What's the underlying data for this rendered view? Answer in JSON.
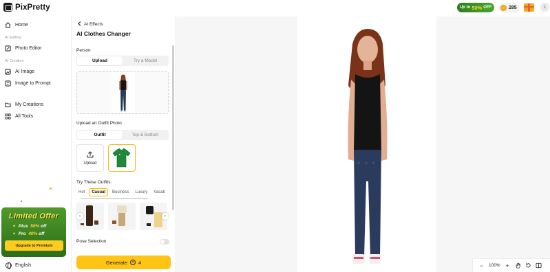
{
  "app": {
    "name": "PixPretty"
  },
  "header": {
    "promo_prefix": "Up to",
    "promo_percent": "50%",
    "promo_suffix": "OFF",
    "coins": "285",
    "avatar_initial": "L"
  },
  "nav": {
    "home": "Home",
    "section_editing": "AI Editing",
    "photo_editor": "Photo Editor",
    "section_creation": "AI Creation",
    "ai_image": "AI Image",
    "image_to_prompt": "Image to Prompt",
    "my_creations": "My Creations",
    "all_tools": "All Tools",
    "language": "English"
  },
  "offer": {
    "title": "Limited Offer",
    "plus_label": "Plus",
    "plus_percent": "50%",
    "plus_suffix": "off",
    "pro_label": "Pro",
    "pro_percent": "40%",
    "pro_suffix": "off",
    "cta": "Upgrade to Premium"
  },
  "panel": {
    "breadcrumb": "AI Effects",
    "title": "AI Clothes Changer",
    "person_label": "Person",
    "person_tabs": [
      "Upload",
      "Try a Model"
    ],
    "outfit_label": "Upload an Outfit Photo",
    "outfit_tabs": [
      "Outfit",
      "Top & Bottom"
    ],
    "upload_tile": "Upload",
    "try_label": "Try These Outfits:",
    "outfit_categories": [
      "Hot",
      "Casual",
      "Business",
      "Luxury",
      "Vacati"
    ],
    "active_category": "Casual",
    "pose_label": "Pose Selection",
    "generate_label": "Generate",
    "generate_cost": "4"
  },
  "canvas": {
    "zoom": "100%"
  },
  "colors": {
    "accent": "#ffc414",
    "promo_green": "#3a8f22",
    "highlight": "#f5b90e"
  }
}
